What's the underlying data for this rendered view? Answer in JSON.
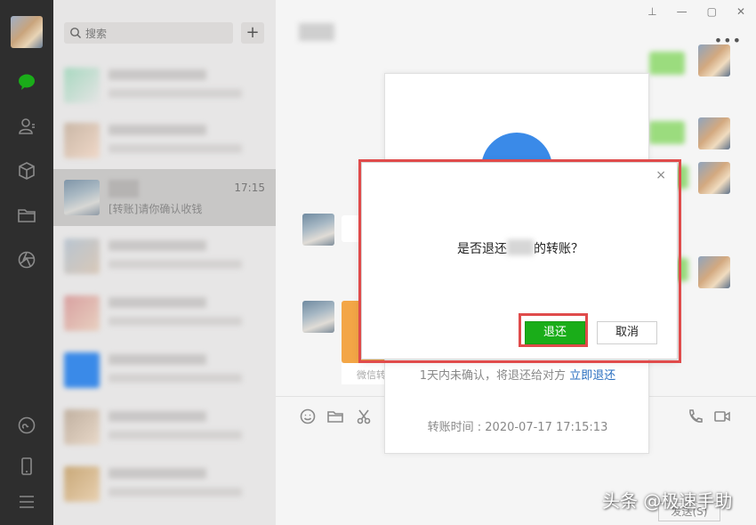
{
  "search": {
    "placeholder": "搜索"
  },
  "chat_list": {
    "selected": {
      "time": "17:15",
      "preview": "[转账]请你确认收钱"
    }
  },
  "window_controls": {
    "pin": "⊥",
    "minimize": "—",
    "maximize": "▢",
    "close": "✕"
  },
  "chat": {
    "more": "•••",
    "send_label": "发送(S)",
    "orange_footer": "微信转"
  },
  "transfer_card": {
    "note_prefix": "1天内未确认，将退还给对方 ",
    "note_link": "立即退还",
    "time_text": "转账时间 : 2020-07-17 17:15:13"
  },
  "dialog": {
    "question_before": "是否退还",
    "question_after": "的转账？",
    "confirm_label": "退还",
    "cancel_label": "取消",
    "close": "×"
  },
  "watermark": "头条 @极速手助",
  "colors": {
    "accent_green": "#1aad19",
    "highlight_red": "#e04b4b",
    "link_blue": "#2a6fc0"
  }
}
